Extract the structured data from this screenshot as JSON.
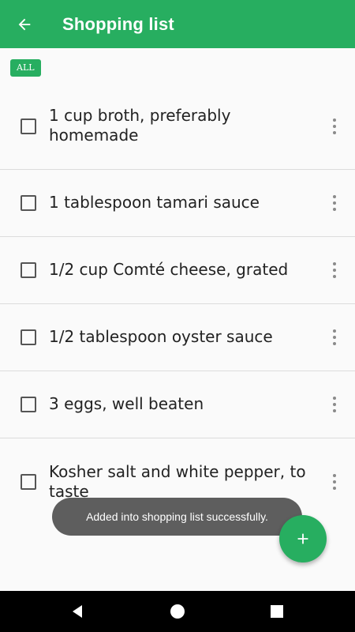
{
  "app_bar": {
    "title": "Shopping list",
    "color": "#27ae60"
  },
  "filter_chip": {
    "label": "ALL"
  },
  "items": [
    {
      "text": "1 cup broth, preferably homemade",
      "checked": false
    },
    {
      "text": "1 tablespoon tamari sauce",
      "checked": false
    },
    {
      "text": "1/2 cup Comté cheese, grated",
      "checked": false
    },
    {
      "text": "1/2 tablespoon oyster sauce",
      "checked": false
    },
    {
      "text": "3 eggs, well beaten",
      "checked": false
    },
    {
      "text": "Kosher salt and white pepper, to taste",
      "checked": false
    }
  ],
  "toast": {
    "message": "Added into shopping list successfully."
  },
  "icons": {
    "back": "arrow-back-icon",
    "more": "more-vert-icon",
    "add": "plus-icon",
    "nav_back": "triangle-back-icon",
    "nav_home": "circle-home-icon",
    "nav_recents": "square-recents-icon"
  }
}
